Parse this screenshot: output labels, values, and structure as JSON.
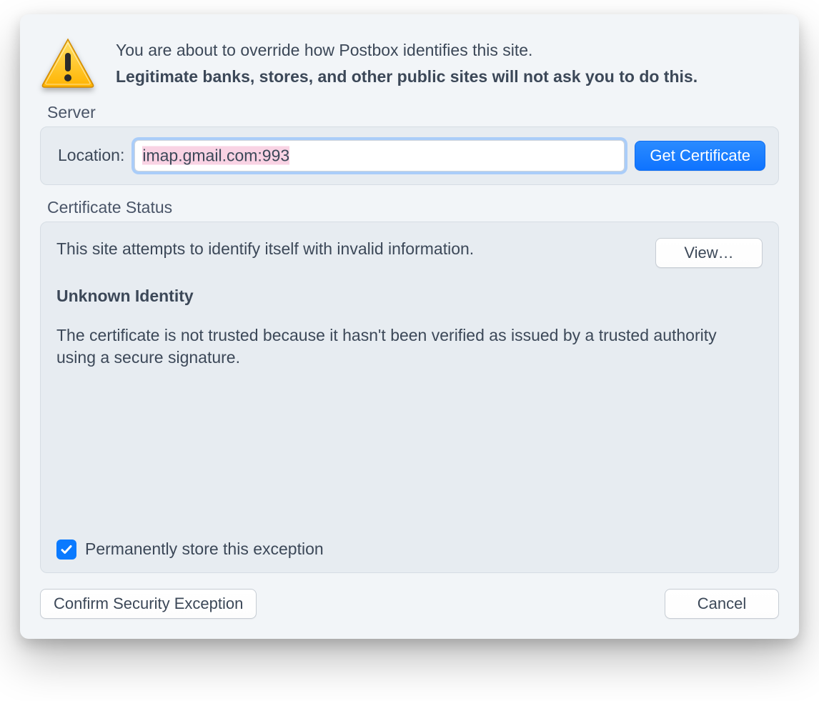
{
  "header": {
    "line1": "You are about to override how Postbox identifies this site.",
    "line2": "Legitimate banks, stores, and other public sites will not ask you to do this."
  },
  "server": {
    "section_label": "Server",
    "location_label": "Location:",
    "location_value": "imap.gmail.com:993",
    "get_cert_label": "Get Certificate"
  },
  "cert": {
    "section_label": "Certificate Status",
    "attempt_text": "This site attempts to identify itself with invalid information.",
    "view_label": "View…",
    "unknown_heading": "Unknown Identity",
    "detail_text": "The certificate is not trusted because it hasn't been verified as issued by a trusted authority using a secure signature.",
    "perm_label": "Permanently store this exception",
    "perm_checked": true
  },
  "footer": {
    "confirm_label": "Confirm Security Exception",
    "cancel_label": "Cancel"
  }
}
